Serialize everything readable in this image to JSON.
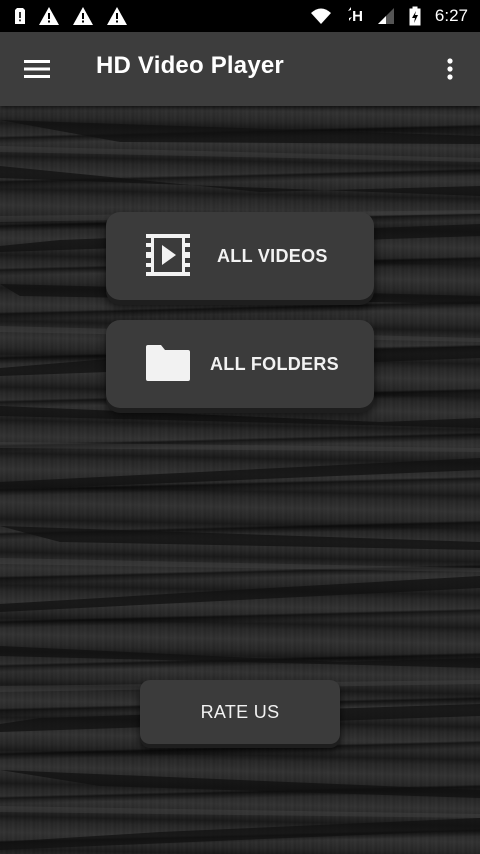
{
  "status_bar": {
    "time": "6:27",
    "network_label": "H",
    "left_icons": [
      "sim-alert-icon",
      "warning-icon",
      "warning-icon",
      "warning-icon"
    ],
    "right_icons": [
      "wifi-icon",
      "data-h-icon",
      "signal-icon",
      "battery-charging-icon"
    ]
  },
  "app_bar": {
    "title": "HD Video Player",
    "menu_icon": "hamburger-menu-icon",
    "overflow_icon": "more-vert-icon",
    "background_color": "#3d3d3d"
  },
  "main": {
    "buttons": [
      {
        "label": "ALL VIDEOS",
        "icon": "video-film-icon"
      },
      {
        "label": "ALL FOLDERS",
        "icon": "folder-icon"
      }
    ],
    "rate_button": {
      "label": "RATE US"
    },
    "button_color": "#3b3b3b"
  }
}
